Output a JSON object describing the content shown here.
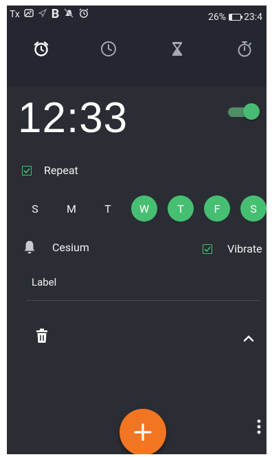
{
  "status_bar": {
    "icons_left": [
      "tx-icon",
      "photo-icon",
      "location-arrow-icon",
      "bluetooth-b-icon",
      "no-notifications-icon",
      "alarm-clock-status-icon"
    ],
    "b_label": "B",
    "tx_label": "Tx",
    "battery_text": "26%",
    "battery_level": 0.26,
    "time": "23:4"
  },
  "tabs": [
    {
      "name": "alarm",
      "icon": "alarm-clock-icon",
      "selected": true
    },
    {
      "name": "clock",
      "icon": "clock-icon",
      "selected": false
    },
    {
      "name": "timer",
      "icon": "hourglass-icon",
      "selected": false
    },
    {
      "name": "stopwatch",
      "icon": "stopwatch-icon",
      "selected": false
    }
  ],
  "alarm": {
    "time": "12:33",
    "enabled": true,
    "repeat_label": "Repeat",
    "repeat_checked": true,
    "days": [
      {
        "label": "S",
        "selected": false
      },
      {
        "label": "M",
        "selected": false
      },
      {
        "label": "T",
        "selected": false
      },
      {
        "label": "W",
        "selected": true
      },
      {
        "label": "T",
        "selected": true
      },
      {
        "label": "F",
        "selected": true
      },
      {
        "label": "S",
        "selected": true
      }
    ],
    "ringtone": "Cesium",
    "vibrate_label": "Vibrate",
    "vibrate_checked": true,
    "label_text": "Label"
  },
  "colors": {
    "background": "#24272f",
    "card": "#2a2d34",
    "accent_green": "#46bf72",
    "fab_orange": "#f27521"
  }
}
